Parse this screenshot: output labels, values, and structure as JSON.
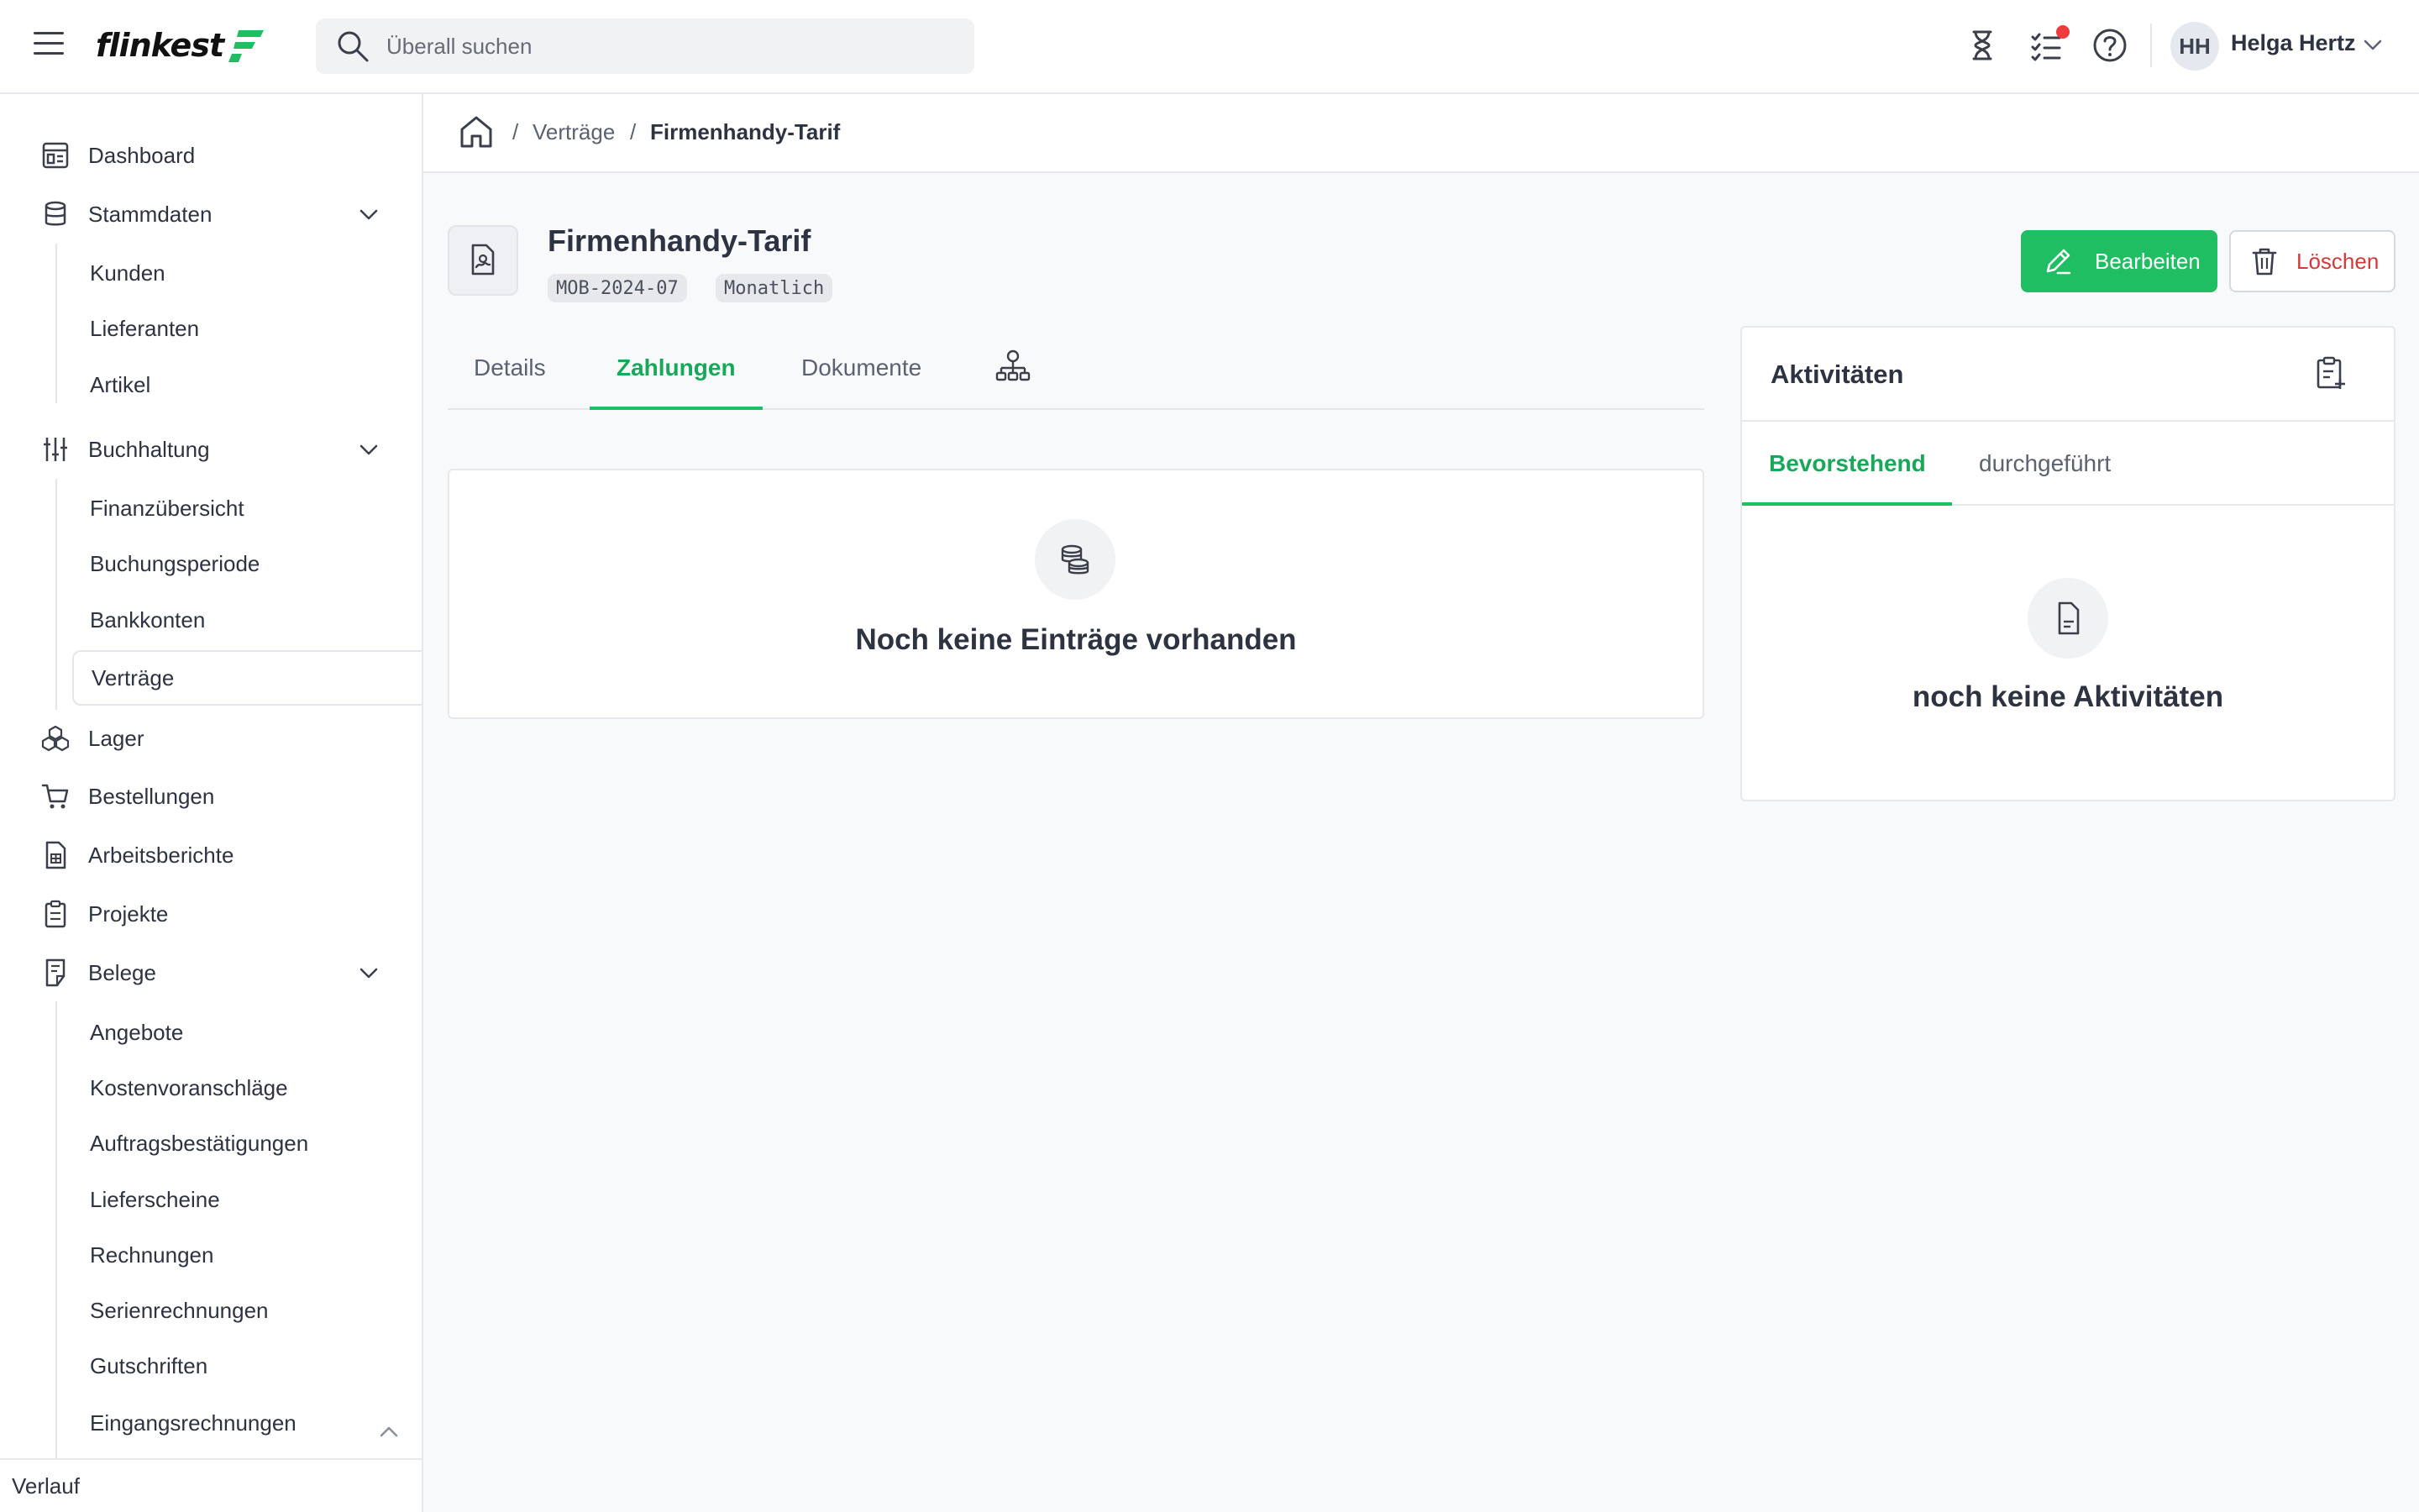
{
  "header": {
    "logo_text": "flinkest",
    "search_placeholder": "Überall suchen",
    "user_initials": "HH",
    "user_name": "Helga Hertz"
  },
  "sidebar": {
    "items": [
      {
        "label": "Dashboard",
        "icon": "dashboard-icon"
      },
      {
        "label": "Stammdaten",
        "icon": "database-icon",
        "expanded": true,
        "children": [
          "Kunden",
          "Lieferanten",
          "Artikel"
        ]
      },
      {
        "label": "Buchhaltung",
        "icon": "adjustments-icon",
        "expanded": true,
        "children": [
          "Finanzübersicht",
          "Buchungsperiode",
          "Bankkonten",
          "Verträge"
        ]
      },
      {
        "label": "Lager",
        "icon": "boxes-icon"
      },
      {
        "label": "Bestellungen",
        "icon": "cart-icon"
      },
      {
        "label": "Arbeitsberichte",
        "icon": "report-icon"
      },
      {
        "label": "Projekte",
        "icon": "clipboard-icon"
      },
      {
        "label": "Belege",
        "icon": "receipt-icon",
        "expanded": true,
        "children": [
          "Angebote",
          "Kostenvoranschläge",
          "Auftragsbestätigungen",
          "Lieferscheine",
          "Rechnungen",
          "Serienrechnungen",
          "Gutschriften",
          "Eingangsrechnungen"
        ]
      }
    ],
    "active_item": "Verträge",
    "footer": "Verlauf"
  },
  "breadcrumb": {
    "items": [
      "Verträge",
      "Firmenhandy-Tarif"
    ],
    "separator": "/"
  },
  "contract": {
    "title": "Firmenhandy-Tarif",
    "badges": [
      "MOB-2024-07",
      "Monatlich"
    ],
    "edit_label": "Bearbeiten",
    "delete_label": "Löschen"
  },
  "tabs": {
    "items": [
      "Details",
      "Zahlungen",
      "Dokumente"
    ],
    "active": "Zahlungen"
  },
  "payments": {
    "empty_text": "Noch keine Einträge vorhanden"
  },
  "activities": {
    "title": "Aktivitäten",
    "tabs": [
      "Bevorstehend",
      "durchgeführt"
    ],
    "active_tab": "Bevorstehend",
    "empty_text": "noch keine Aktivitäten"
  },
  "colors": {
    "accent": "#1fbe62",
    "accent_text": "#17a85a",
    "danger": "#d23a3a",
    "notification": "#ef3b3b"
  }
}
